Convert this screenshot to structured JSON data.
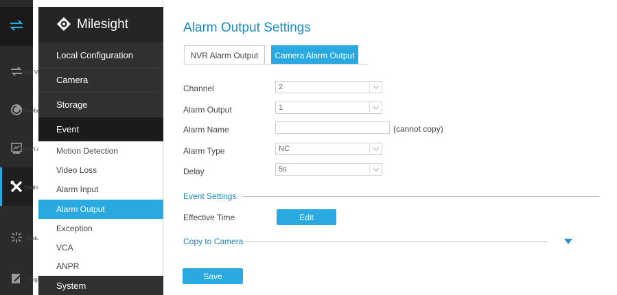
{
  "brand": {
    "name": "Milesight"
  },
  "rail": {
    "items": [
      {
        "label": "Live View",
        "icon": "live-view-icon"
      },
      {
        "label": "Playback",
        "icon": "playback-icon"
      },
      {
        "label": "Smart An...",
        "icon": "smart-analytics-icon"
      },
      {
        "label": "Settings",
        "icon": "settings-icon"
      },
      {
        "label": "Status",
        "icon": "status-icon"
      },
      {
        "label": "Logs",
        "icon": "logs-icon"
      }
    ]
  },
  "menu": {
    "local_configuration": "Local Configuration",
    "camera": "Camera",
    "storage": "Storage",
    "event": "Event",
    "sub_items": [
      "Motion Detection",
      "Video Loss",
      "Alarm Input",
      "Alarm Output",
      "Exception",
      "VCA",
      "ANPR"
    ],
    "active_sub_item": "Alarm Output",
    "system": "System"
  },
  "page": {
    "title": "Alarm Output Settings",
    "tabs": [
      "NVR Alarm Output",
      "Camera Alarm Output"
    ],
    "active_tab": "Camera Alarm Output"
  },
  "form": {
    "channel": {
      "label": "Channel",
      "value": "2"
    },
    "alarm_output": {
      "label": "Alarm Output",
      "value": "1"
    },
    "alarm_name": {
      "label": "Alarm Name",
      "value": "",
      "note": "(cannot copy)"
    },
    "alarm_type": {
      "label": "Alarm Type",
      "value": "NC"
    },
    "delay": {
      "label": "Delay",
      "value": "5s"
    }
  },
  "event_settings": {
    "title": "Event Settings",
    "effective_time_label": "Effective Time",
    "edit_button": "Edit"
  },
  "copy_to_camera": {
    "title": "Copy to Camera"
  },
  "save_button": "Save",
  "colors": {
    "accent": "#2aa8e0",
    "title": "#1a8ac4",
    "rail_bg": "#2b2b2b",
    "menu_dark": "#303030"
  }
}
